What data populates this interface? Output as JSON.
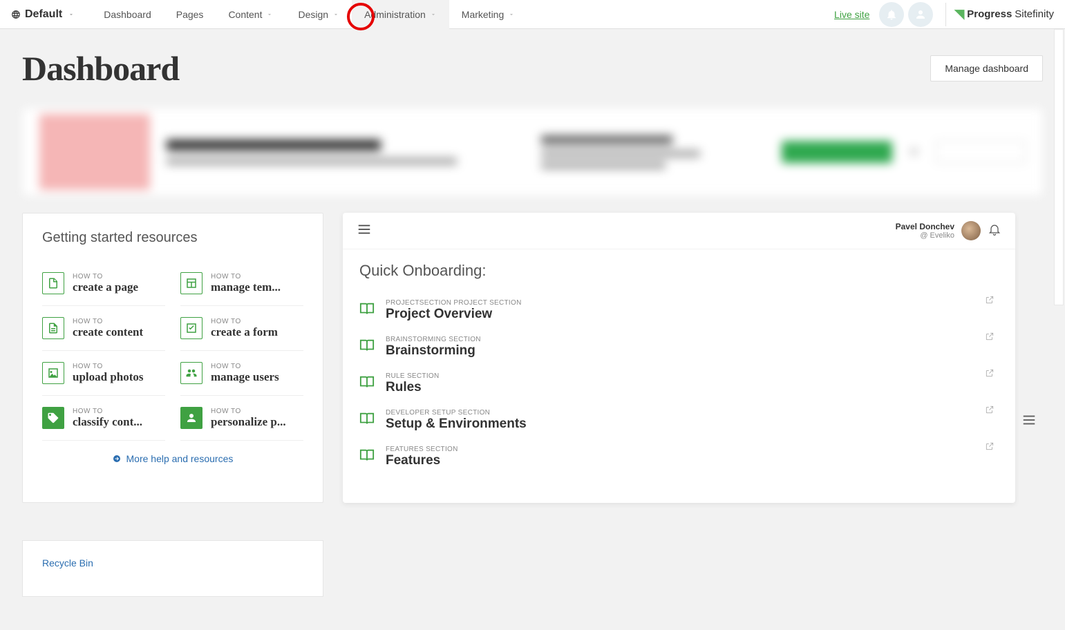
{
  "nav": {
    "site": "Default",
    "items": [
      "Dashboard",
      "Pages",
      "Content",
      "Design",
      "Administration",
      "Marketing"
    ],
    "dropdown": [
      false,
      false,
      true,
      true,
      true,
      true
    ],
    "active_index": 4,
    "live_site": "Live site",
    "brand_left": "Progress",
    "brand_right": "Sitefinity"
  },
  "page": {
    "title": "Dashboard",
    "manage_btn": "Manage dashboard"
  },
  "getting_started": {
    "heading": "Getting started resources",
    "howto": "HOW TO",
    "items": [
      {
        "title": "create a page",
        "icon": "file"
      },
      {
        "title": "manage tem...",
        "icon": "layout"
      },
      {
        "title": "create content",
        "icon": "doc"
      },
      {
        "title": "create a form",
        "icon": "check"
      },
      {
        "title": "upload photos",
        "icon": "image"
      },
      {
        "title": "manage users",
        "icon": "users"
      },
      {
        "title": "classify cont...",
        "icon": "tag",
        "solid": true
      },
      {
        "title": "personalize p...",
        "icon": "person",
        "solid": true
      }
    ],
    "more": "More help and resources"
  },
  "onboarding": {
    "user_name": "Pavel Donchev",
    "user_handle": "@ Eveliko",
    "heading": "Quick Onboarding:",
    "items": [
      {
        "section": "PROJECTSECTION PROJECT SECTION",
        "title": "Project Overview"
      },
      {
        "section": "BRAINSTORMING SECTION",
        "title": "Brainstorming"
      },
      {
        "section": "RULE SECTION",
        "title": "Rules"
      },
      {
        "section": "DEVELOPER SETUP SECTION",
        "title": "Setup & Environments"
      },
      {
        "section": "FEATURES SECTION",
        "title": "Features"
      }
    ]
  },
  "recycle": {
    "title": "Recycle Bin"
  }
}
